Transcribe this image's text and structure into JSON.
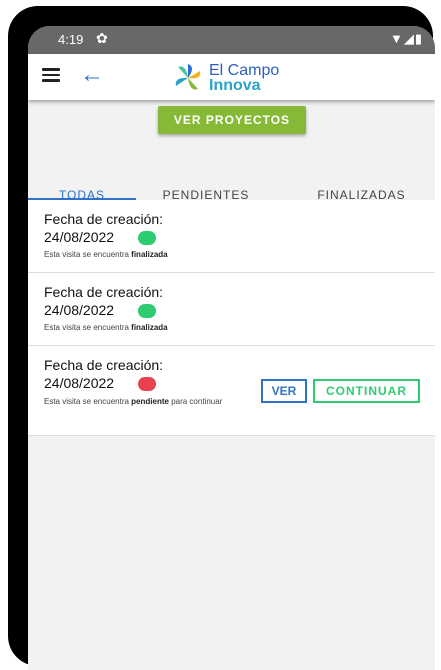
{
  "status_bar": {
    "time": "4:19"
  },
  "app_bar": {
    "logo_line1": "El Campo",
    "logo_line2": "Innova"
  },
  "main": {
    "projects_button": "VER PROYECTOS",
    "tabs": [
      {
        "label": "TODAS",
        "active": true
      },
      {
        "label": "PENDIENTES",
        "active": false
      },
      {
        "label": "FINALIZADAS",
        "active": false
      }
    ],
    "visits": [
      {
        "label": "Fecha de creación:",
        "date": "24/08/2022",
        "status": "finalizada",
        "status_color": "#2ecc71",
        "note_prefix": "Esta visita se encuentra",
        "note_status": "finalizada",
        "note_suffix": ""
      },
      {
        "label": "Fecha de creación:",
        "date": "24/08/2022",
        "status": "finalizada",
        "status_color": "#2ecc71",
        "note_prefix": "Esta visita se encuentra",
        "note_status": "finalizada",
        "note_suffix": ""
      },
      {
        "label": "Fecha de creación:",
        "date": "24/08/2022",
        "status": "pendiente",
        "status_color": "#e8414f",
        "note_prefix": "Esta visita se encuentra",
        "note_status": "pendiente",
        "note_suffix": "para continuar",
        "view_button": "VER",
        "continue_button": "CONTINUAR"
      }
    ]
  },
  "colors": {
    "primary": "#2e73c7",
    "accent_green": "#86b935",
    "success": "#2ecc71",
    "danger": "#e8414f"
  }
}
